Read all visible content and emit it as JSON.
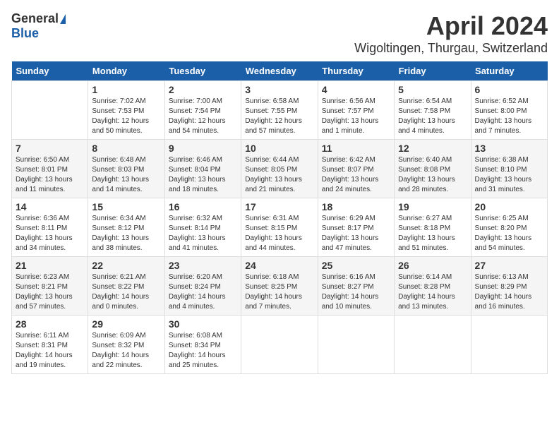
{
  "header": {
    "logo_general": "General",
    "logo_blue": "Blue",
    "month_title": "April 2024",
    "location": "Wigoltingen, Thurgau, Switzerland"
  },
  "weekdays": [
    "Sunday",
    "Monday",
    "Tuesday",
    "Wednesday",
    "Thursday",
    "Friday",
    "Saturday"
  ],
  "weeks": [
    [
      {
        "day": "",
        "info": ""
      },
      {
        "day": "1",
        "info": "Sunrise: 7:02 AM\nSunset: 7:53 PM\nDaylight: 12 hours\nand 50 minutes."
      },
      {
        "day": "2",
        "info": "Sunrise: 7:00 AM\nSunset: 7:54 PM\nDaylight: 12 hours\nand 54 minutes."
      },
      {
        "day": "3",
        "info": "Sunrise: 6:58 AM\nSunset: 7:55 PM\nDaylight: 12 hours\nand 57 minutes."
      },
      {
        "day": "4",
        "info": "Sunrise: 6:56 AM\nSunset: 7:57 PM\nDaylight: 13 hours\nand 1 minute."
      },
      {
        "day": "5",
        "info": "Sunrise: 6:54 AM\nSunset: 7:58 PM\nDaylight: 13 hours\nand 4 minutes."
      },
      {
        "day": "6",
        "info": "Sunrise: 6:52 AM\nSunset: 8:00 PM\nDaylight: 13 hours\nand 7 minutes."
      }
    ],
    [
      {
        "day": "7",
        "info": "Sunrise: 6:50 AM\nSunset: 8:01 PM\nDaylight: 13 hours\nand 11 minutes."
      },
      {
        "day": "8",
        "info": "Sunrise: 6:48 AM\nSunset: 8:03 PM\nDaylight: 13 hours\nand 14 minutes."
      },
      {
        "day": "9",
        "info": "Sunrise: 6:46 AM\nSunset: 8:04 PM\nDaylight: 13 hours\nand 18 minutes."
      },
      {
        "day": "10",
        "info": "Sunrise: 6:44 AM\nSunset: 8:05 PM\nDaylight: 13 hours\nand 21 minutes."
      },
      {
        "day": "11",
        "info": "Sunrise: 6:42 AM\nSunset: 8:07 PM\nDaylight: 13 hours\nand 24 minutes."
      },
      {
        "day": "12",
        "info": "Sunrise: 6:40 AM\nSunset: 8:08 PM\nDaylight: 13 hours\nand 28 minutes."
      },
      {
        "day": "13",
        "info": "Sunrise: 6:38 AM\nSunset: 8:10 PM\nDaylight: 13 hours\nand 31 minutes."
      }
    ],
    [
      {
        "day": "14",
        "info": "Sunrise: 6:36 AM\nSunset: 8:11 PM\nDaylight: 13 hours\nand 34 minutes."
      },
      {
        "day": "15",
        "info": "Sunrise: 6:34 AM\nSunset: 8:12 PM\nDaylight: 13 hours\nand 38 minutes."
      },
      {
        "day": "16",
        "info": "Sunrise: 6:32 AM\nSunset: 8:14 PM\nDaylight: 13 hours\nand 41 minutes."
      },
      {
        "day": "17",
        "info": "Sunrise: 6:31 AM\nSunset: 8:15 PM\nDaylight: 13 hours\nand 44 minutes."
      },
      {
        "day": "18",
        "info": "Sunrise: 6:29 AM\nSunset: 8:17 PM\nDaylight: 13 hours\nand 47 minutes."
      },
      {
        "day": "19",
        "info": "Sunrise: 6:27 AM\nSunset: 8:18 PM\nDaylight: 13 hours\nand 51 minutes."
      },
      {
        "day": "20",
        "info": "Sunrise: 6:25 AM\nSunset: 8:20 PM\nDaylight: 13 hours\nand 54 minutes."
      }
    ],
    [
      {
        "day": "21",
        "info": "Sunrise: 6:23 AM\nSunset: 8:21 PM\nDaylight: 13 hours\nand 57 minutes."
      },
      {
        "day": "22",
        "info": "Sunrise: 6:21 AM\nSunset: 8:22 PM\nDaylight: 14 hours\nand 0 minutes."
      },
      {
        "day": "23",
        "info": "Sunrise: 6:20 AM\nSunset: 8:24 PM\nDaylight: 14 hours\nand 4 minutes."
      },
      {
        "day": "24",
        "info": "Sunrise: 6:18 AM\nSunset: 8:25 PM\nDaylight: 14 hours\nand 7 minutes."
      },
      {
        "day": "25",
        "info": "Sunrise: 6:16 AM\nSunset: 8:27 PM\nDaylight: 14 hours\nand 10 minutes."
      },
      {
        "day": "26",
        "info": "Sunrise: 6:14 AM\nSunset: 8:28 PM\nDaylight: 14 hours\nand 13 minutes."
      },
      {
        "day": "27",
        "info": "Sunrise: 6:13 AM\nSunset: 8:29 PM\nDaylight: 14 hours\nand 16 minutes."
      }
    ],
    [
      {
        "day": "28",
        "info": "Sunrise: 6:11 AM\nSunset: 8:31 PM\nDaylight: 14 hours\nand 19 minutes."
      },
      {
        "day": "29",
        "info": "Sunrise: 6:09 AM\nSunset: 8:32 PM\nDaylight: 14 hours\nand 22 minutes."
      },
      {
        "day": "30",
        "info": "Sunrise: 6:08 AM\nSunset: 8:34 PM\nDaylight: 14 hours\nand 25 minutes."
      },
      {
        "day": "",
        "info": ""
      },
      {
        "day": "",
        "info": ""
      },
      {
        "day": "",
        "info": ""
      },
      {
        "day": "",
        "info": ""
      }
    ]
  ]
}
